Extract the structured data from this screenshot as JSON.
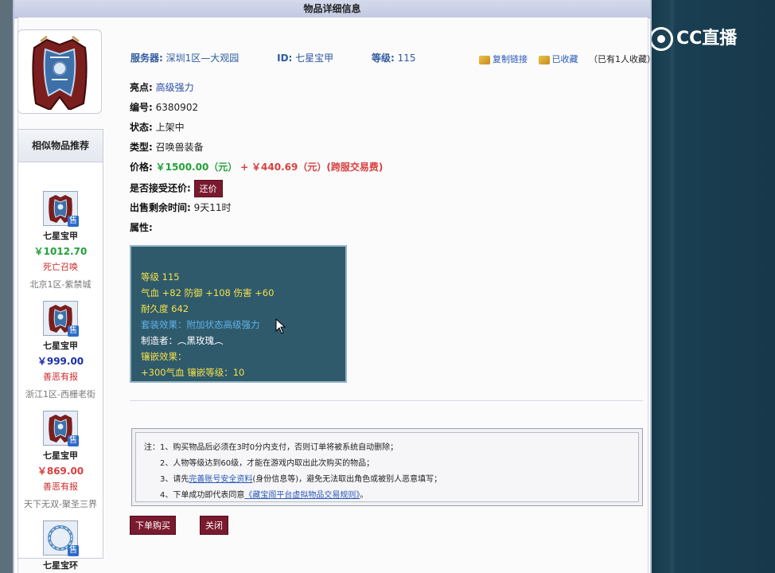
{
  "window": {
    "title": "物品详细信息"
  },
  "brand": {
    "logo_text": "CC直播"
  },
  "item": {
    "server_label": "服务器:",
    "server": "深圳1区—大观园",
    "id_label": "ID:",
    "id": "七星宝甲",
    "level_label": "等级:",
    "level": "115",
    "highlight_label": "亮点:",
    "highlight": "高级强力",
    "number_label": "编号:",
    "number": "6380902",
    "status_label": "状态:",
    "status": "上架中",
    "type_label": "类型:",
    "type": "召唤兽装备",
    "price_label": "价格:",
    "price": "￥1500.00（元）",
    "plus": "+",
    "fee": "￥440.69（元）(跨服交易费)",
    "bargain_label": "是否接受还价:",
    "bargain_button": "还价",
    "remaining_label": "出售剩余时间:",
    "remaining": "9天11时",
    "attrs_label": "属性:"
  },
  "actions": {
    "copy_link": "复制链接",
    "favorited": "已收藏",
    "fav_count": "（已有1人收藏）"
  },
  "attributes": {
    "line1": "等级 115",
    "line2": "气血 +82 防御 +108 伤害 +60",
    "line3": "耐久度 642",
    "line4": "套装效果：附加状态高级强力",
    "line5": "制造者：︵黑玫瑰︵",
    "line6": "镶嵌效果：",
    "line7": "+300气血 镶嵌等级：10"
  },
  "sidebar": {
    "title": "相似物品推荐",
    "items": [
      {
        "name": "七星宝甲",
        "price": "￥1012.70",
        "attr": "死亡召唤",
        "server": "北京1区-紫禁城",
        "badge": "售"
      },
      {
        "name": "七星宝甲",
        "price": "￥999.00",
        "attr": "善恶有报",
        "server": "浙江1区-西栅老街",
        "badge": "售"
      },
      {
        "name": "七星宝甲",
        "price": "￥869.00",
        "attr": "善恶有报",
        "server": "天下无双-聚圣三界",
        "badge": "售"
      },
      {
        "name": "七星宝环",
        "badge": "售"
      }
    ]
  },
  "notice": {
    "prefix": "注：",
    "line1": "1、购买物品后必须在3时0分内支付，否则订单将被系统自动删除；",
    "line2": "2、人物等级达到60级，才能在游戏内取出此次购买的物品；",
    "line3_a": "3、请先",
    "line3_link": "完善账号安全资料",
    "line3_b": "(身份信息等)，避免无法取出角色或被别人恶意填写；",
    "line4_a": "4、下单成功即代表同意",
    "line4_link": "《藏宝阁平台虚拟物品交易规则》",
    "line4_b": "。"
  },
  "buttons": {
    "buy": "下单购买",
    "close": "关闭"
  },
  "colors": {
    "price_green": "#22a23a",
    "fee_red": "#d84040",
    "button_maroon": "#7a1a2e",
    "attr_bg": "#2f5a6c",
    "link_blue": "#2a58b8"
  }
}
